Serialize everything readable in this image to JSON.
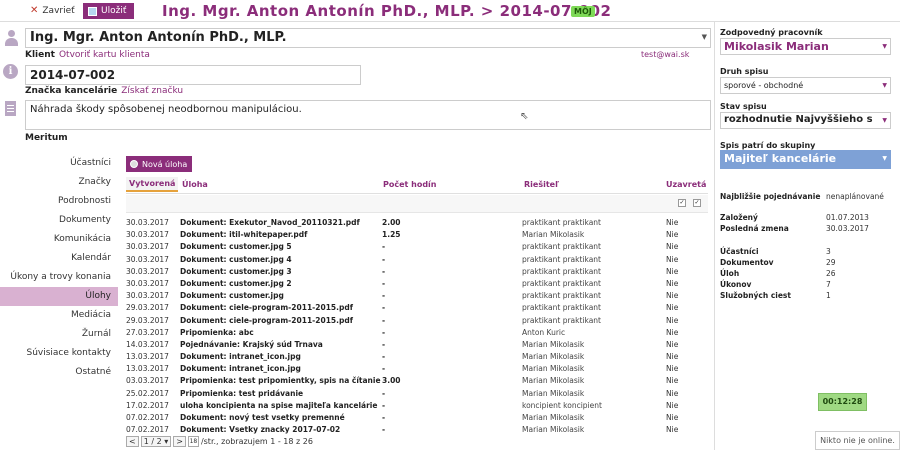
{
  "toolbar": {
    "close_label": "Zavrieť",
    "save_label": "Uložiť",
    "case_title": "Ing. Mgr. Anton Antonín PhD., MLP. > 2014-07-002",
    "badge": "MÔJ"
  },
  "client": {
    "name": "Ing. Mgr. Anton Antonín PhD., MLP.",
    "label": "Klient",
    "open_link": "Otvoriť kartu klienta",
    "email": "test@wai.sk"
  },
  "office_mark": {
    "value": "2014-07-002",
    "label": "Značka kancelárie",
    "get_link": "Získať značku"
  },
  "description": {
    "value": "Náhrada škody spôsobenej neodbornou manipuláciou.",
    "label": "Meritum"
  },
  "nav": {
    "items": [
      {
        "label": "Účastníci"
      },
      {
        "label": "Značky"
      },
      {
        "label": "Podrobnosti"
      },
      {
        "label": "Dokumenty"
      },
      {
        "label": "Komunikácia"
      },
      {
        "label": "Kalendár"
      },
      {
        "label": "Úkony a trovy konania"
      },
      {
        "label": "Úlohy",
        "active": true
      },
      {
        "label": "Mediácia"
      },
      {
        "label": "Žurnál"
      },
      {
        "label": "Súvisiace kontakty"
      },
      {
        "label": "Ostatné"
      }
    ]
  },
  "tasks": {
    "new_label": "Nová úloha",
    "headers": {
      "created": "Vytvorená",
      "task": "Úloha",
      "hours": "Počet hodín",
      "solver": "Riešiteľ",
      "closed": "Uzavretá"
    },
    "rows": [
      {
        "date": "30.03.2017",
        "task": "Dokument: Exekutor_Navod_20110321.pdf",
        "hours": "2.00",
        "solver": "praktikant praktikant",
        "closed": "Nie"
      },
      {
        "date": "30.03.2017",
        "task": "Dokument: itil-whitepaper.pdf",
        "hours": "1.25",
        "solver": "Marian Mikolasik",
        "closed": "Nie"
      },
      {
        "date": "30.03.2017",
        "task": "Dokument: customer.jpg 5",
        "hours": "-",
        "solver": "praktikant praktikant",
        "closed": "Nie"
      },
      {
        "date": "30.03.2017",
        "task": "Dokument: customer.jpg 4",
        "hours": "-",
        "solver": "praktikant praktikant",
        "closed": "Nie"
      },
      {
        "date": "30.03.2017",
        "task": "Dokument: customer.jpg 3",
        "hours": "-",
        "solver": "praktikant praktikant",
        "closed": "Nie"
      },
      {
        "date": "30.03.2017",
        "task": "Dokument: customer.jpg 2",
        "hours": "-",
        "solver": "praktikant praktikant",
        "closed": "Nie"
      },
      {
        "date": "30.03.2017",
        "task": "Dokument: customer.jpg",
        "hours": "-",
        "solver": "praktikant praktikant",
        "closed": "Nie"
      },
      {
        "date": "29.03.2017",
        "task": "Dokument: ciele-program-2011-2015.pdf",
        "hours": "-",
        "solver": "praktikant praktikant",
        "closed": "Nie"
      },
      {
        "date": "29.03.2017",
        "task": "Dokument: ciele-program-2011-2015.pdf",
        "hours": "-",
        "solver": "praktikant praktikant",
        "closed": "Nie"
      },
      {
        "date": "27.03.2017",
        "task": "Pripomienka: abc",
        "hours": "-",
        "solver": "Anton Kuric",
        "closed": "Nie"
      },
      {
        "date": "14.03.2017",
        "task": "Pojednávanie: Krajský súd Trnava",
        "hours": "-",
        "solver": "Marian Mikolasik",
        "closed": "Nie"
      },
      {
        "date": "13.03.2017",
        "task": "Dokument: intranet_icon.jpg",
        "hours": "-",
        "solver": "Marian Mikolasik",
        "closed": "Nie"
      },
      {
        "date": "13.03.2017",
        "task": "Dokument: intranet_icon.jpg",
        "hours": "-",
        "solver": "Marian Mikolasik",
        "closed": "Nie"
      },
      {
        "date": "03.03.2017",
        "task": "Pripomienka: test pripomientky, spis na čítanie",
        "hours": "3.00",
        "solver": "Marian Mikolasik",
        "closed": "Nie"
      },
      {
        "date": "25.02.2017",
        "task": "Pripomienka: test pridávanie",
        "hours": "-",
        "solver": "Marian Mikolasik",
        "closed": "Nie"
      },
      {
        "date": "17.02.2017",
        "task": "uloha koncipienta na spise majiteľa kancelárie",
        "hours": "-",
        "solver": "koncipient koncipient",
        "closed": "Nie"
      },
      {
        "date": "07.02.2017",
        "task": "Dokument: nový test vsetky premenné",
        "hours": "-",
        "solver": "Marian Mikolasik",
        "closed": "Nie"
      },
      {
        "date": "07.02.2017",
        "task": "Dokument: Vsetky znacky 2017-07-02",
        "hours": "-",
        "solver": "Marian Mikolasik",
        "closed": "Nie"
      }
    ],
    "pager": {
      "prev": "<",
      "page": "1 / 2",
      "next": ">",
      "per_page": "18",
      "summary": "/str., zobrazujem 1 - 18 z 26"
    }
  },
  "right": {
    "worker_label": "Zodpovedný pracovník",
    "worker_value": "Mikolasik Marian",
    "type_label": "Druh spisu",
    "type_value": "sporové - obchodné",
    "state_label": "Stav spisu",
    "state_value": "rozhodnutie Najvyššieho s",
    "group_label": "Spis patrí do skupiny",
    "group_value": "Majiteľ kancelárie",
    "hearing_label": "Najbližšie pojednávanie",
    "hearing_value": "nenaplánované",
    "founded_label": "Založený",
    "founded_value": "01.07.2013",
    "last_change_label": "Posledná zmena",
    "last_change_value": "30.03.2017",
    "stats": [
      {
        "label": "Účastníci",
        "value": "3"
      },
      {
        "label": "Dokumentov",
        "value": "29"
      },
      {
        "label": "Úloh",
        "value": "26"
      },
      {
        "label": "Úkonov",
        "value": "7"
      },
      {
        "label": "Služobných ciest",
        "value": "1"
      }
    ],
    "timer": "00:12:28",
    "online": "Nikto nie je online."
  }
}
